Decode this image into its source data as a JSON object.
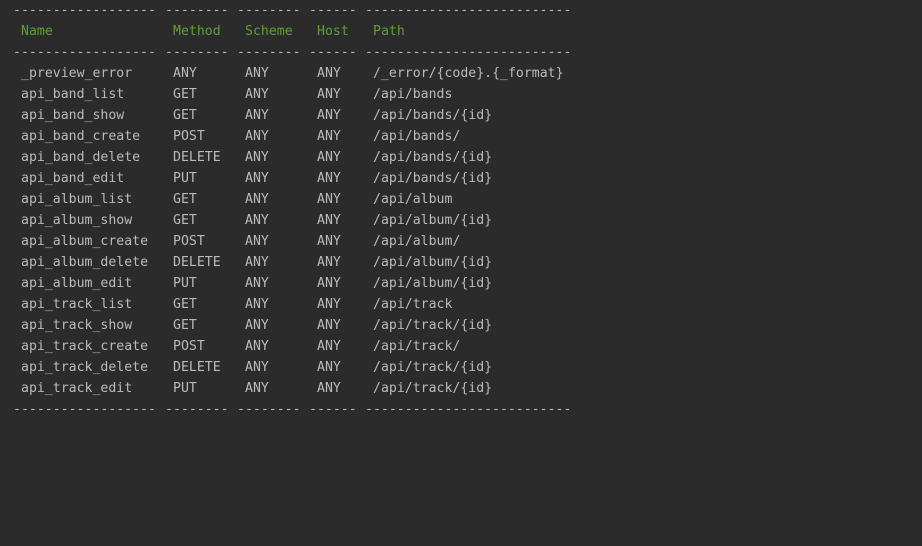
{
  "rule": {
    "name": "------------------",
    "method": "--------",
    "scheme": "--------",
    "host": "------",
    "path": "--------------------------"
  },
  "header": {
    "name": "Name",
    "method": "Method",
    "scheme": "Scheme",
    "host": "Host",
    "path": "Path"
  },
  "rows": [
    {
      "name": "_preview_error",
      "method": "ANY",
      "scheme": "ANY",
      "host": "ANY",
      "path": "/_error/{code}.{_format}"
    },
    {
      "name": "api_band_list",
      "method": "GET",
      "scheme": "ANY",
      "host": "ANY",
      "path": "/api/bands"
    },
    {
      "name": "api_band_show",
      "method": "GET",
      "scheme": "ANY",
      "host": "ANY",
      "path": "/api/bands/{id}"
    },
    {
      "name": "api_band_create",
      "method": "POST",
      "scheme": "ANY",
      "host": "ANY",
      "path": "/api/bands/"
    },
    {
      "name": "api_band_delete",
      "method": "DELETE",
      "scheme": "ANY",
      "host": "ANY",
      "path": "/api/bands/{id}"
    },
    {
      "name": "api_band_edit",
      "method": "PUT",
      "scheme": "ANY",
      "host": "ANY",
      "path": "/api/bands/{id}"
    },
    {
      "name": "api_album_list",
      "method": "GET",
      "scheme": "ANY",
      "host": "ANY",
      "path": "/api/album"
    },
    {
      "name": "api_album_show",
      "method": "GET",
      "scheme": "ANY",
      "host": "ANY",
      "path": "/api/album/{id}"
    },
    {
      "name": "api_album_create",
      "method": "POST",
      "scheme": "ANY",
      "host": "ANY",
      "path": "/api/album/"
    },
    {
      "name": "api_album_delete",
      "method": "DELETE",
      "scheme": "ANY",
      "host": "ANY",
      "path": "/api/album/{id}"
    },
    {
      "name": "api_album_edit",
      "method": "PUT",
      "scheme": "ANY",
      "host": "ANY",
      "path": "/api/album/{id}"
    },
    {
      "name": "api_track_list",
      "method": "GET",
      "scheme": "ANY",
      "host": "ANY",
      "path": "/api/track"
    },
    {
      "name": "api_track_show",
      "method": "GET",
      "scheme": "ANY",
      "host": "ANY",
      "path": "/api/track/{id}"
    },
    {
      "name": "api_track_create",
      "method": "POST",
      "scheme": "ANY",
      "host": "ANY",
      "path": "/api/track/"
    },
    {
      "name": "api_track_delete",
      "method": "DELETE",
      "scheme": "ANY",
      "host": "ANY",
      "path": "/api/track/{id}"
    },
    {
      "name": "api_track_edit",
      "method": "PUT",
      "scheme": "ANY",
      "host": "ANY",
      "path": "/api/track/{id}"
    }
  ],
  "colors": {
    "background": "#2b2b2b",
    "text": "#bbbbbb",
    "header": "#5f9f3b"
  }
}
